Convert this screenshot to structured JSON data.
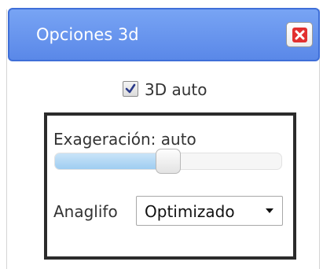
{
  "dialog": {
    "title": "Opciones 3d",
    "close_icon": "close-icon"
  },
  "auto3d": {
    "label": "3D auto",
    "checked": true
  },
  "exaggeration": {
    "label": "Exageración: auto",
    "slider_fraction": 0.5
  },
  "anaglyph": {
    "label": "Anaglifo",
    "selected": "Optimizado"
  },
  "colors": {
    "titlebar": "#5f8eeb",
    "close": "#e2302f",
    "slider_fill": "#a9d3f3",
    "frame": "#2b2b2b"
  }
}
